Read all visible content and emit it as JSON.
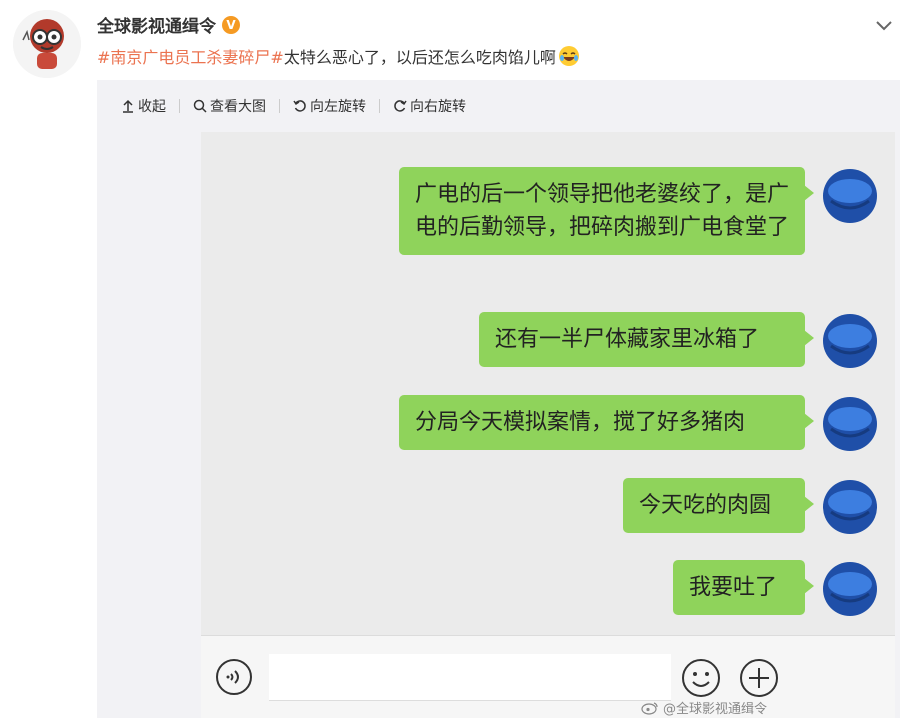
{
  "header": {
    "username": "全球影视通缉令",
    "verified_badge": "V"
  },
  "post": {
    "hashtag": "#南京广电员工杀妻碎尸#",
    "text": " 太特么恶心了，以后还怎么吃肉馅儿啊"
  },
  "toolbar": {
    "collapse_label": "收起",
    "view_large_label": "查看大图",
    "rotate_left_label": "向左旋转",
    "rotate_right_label": "向右旋转"
  },
  "chat": {
    "messages": [
      {
        "text": "广电的后一个领导把他老婆绞了，是广电的后勤领导，把碎肉搬到广电食堂了"
      },
      {
        "text": "还有一半尸体藏家里冰箱了"
      },
      {
        "text": "分局今天模拟案情，搅了好多猪肉"
      },
      {
        "text": "今天吃的肉圆"
      },
      {
        "text": "我要吐了"
      }
    ]
  },
  "watermark": {
    "text": "@全球影视通缉令"
  },
  "colors": {
    "hashtag": "#eb7350",
    "bubble": "#8fd35b",
    "verified": "#f59a23"
  }
}
